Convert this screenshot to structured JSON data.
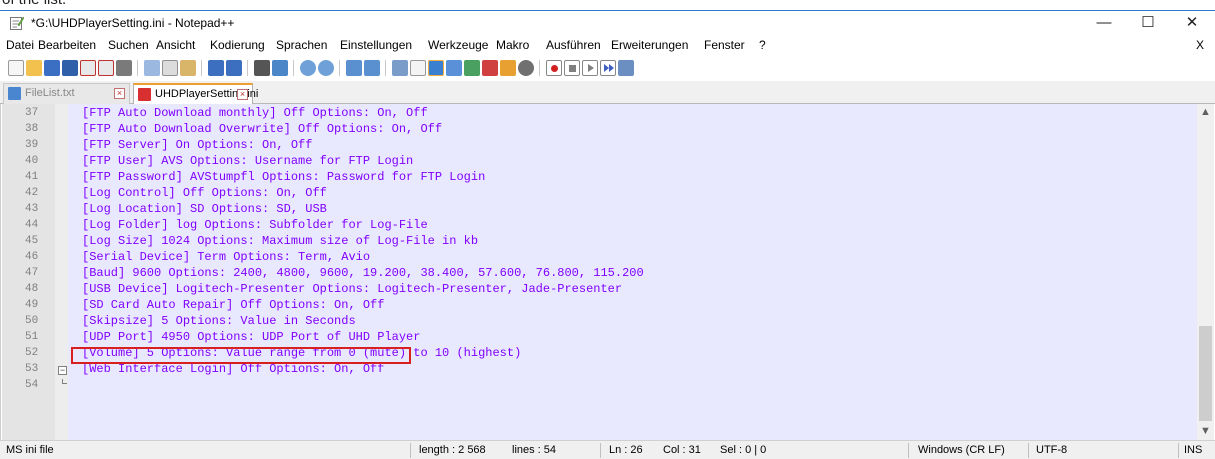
{
  "above_window_text": "of the list.",
  "window": {
    "title": "*G:\\UHDPlayerSetting.ini - Notepad++",
    "minimize": "—",
    "maximize": "☐",
    "close": "✕"
  },
  "menu": {
    "items": [
      "Datei",
      "Bearbeiten",
      "Suchen",
      "Ansicht",
      "Kodierung",
      "Sprachen",
      "Einstellungen",
      "Werkzeuge",
      "Makro",
      "Ausführen",
      "Erweiterungen",
      "Fenster",
      "?"
    ],
    "close_doc": "X"
  },
  "toolbar": {
    "icons": [
      "new-file-icon",
      "open-file-icon",
      "save-icon",
      "save-all-icon",
      "close-icon",
      "close-all-icon",
      "print-icon",
      "cut-icon",
      "copy-icon",
      "paste-icon",
      "undo-icon",
      "redo-icon",
      "find-icon",
      "replace-icon",
      "zoom-in-icon",
      "zoom-out-icon",
      "sync-vertical-icon",
      "sync-horizontal-icon",
      "word-wrap-icon",
      "show-all-chars-icon",
      "indent-guide-icon",
      "user-lang-icon",
      "doc-map-icon",
      "function-list-icon",
      "folder-workspace-icon",
      "monitor-icon",
      "record-macro-icon",
      "stop-record-icon",
      "play-macro-icon",
      "run-multiple-icon",
      "save-macro-icon"
    ]
  },
  "tabs": [
    {
      "label": "FileList.txt",
      "active": false,
      "close": "×"
    },
    {
      "label": "UHDPlayerSetting.ini",
      "active": true,
      "close": "×"
    }
  ],
  "editor": {
    "lines": [
      {
        "n": "37",
        "text": "[FTP Auto Download monthly] Off Options: On, Off"
      },
      {
        "n": "38",
        "text": "[FTP Auto Download Overwrite] Off Options: On, Off"
      },
      {
        "n": "39",
        "text": "[FTP Server] On Options: On, Off"
      },
      {
        "n": "40",
        "text": "[FTP User] AVS Options: Username for FTP Login"
      },
      {
        "n": "41",
        "text": "[FTP Password] AVStumpfl Options: Password for FTP Login"
      },
      {
        "n": "42",
        "text": "[Log Control] Off Options: On, Off"
      },
      {
        "n": "43",
        "text": "[Log Location] SD Options: SD, USB"
      },
      {
        "n": "44",
        "text": "[Log Folder] log Options: Subfolder for Log-File"
      },
      {
        "n": "45",
        "text": "[Log Size] 1024 Options: Maximum size of Log-File in kb"
      },
      {
        "n": "46",
        "text": "[Serial Device] Term Options: Term, Avio"
      },
      {
        "n": "47",
        "text": "[Baud] 9600 Options: 2400, 4800, 9600, 19.200, 38.400, 57.600, 76.800, 115.200"
      },
      {
        "n": "48",
        "text": "[USB Device] Logitech-Presenter Options: Logitech-Presenter, Jade-Presenter"
      },
      {
        "n": "49",
        "text": "[SD Card Auto Repair] Off Options: On, Off"
      },
      {
        "n": "50",
        "text": "[Skipsize] 5 Options: Value in Seconds"
      },
      {
        "n": "51",
        "text": "[UDP Port] 4950 Options: UDP Port of UHD Player"
      },
      {
        "n": "52",
        "text": "[Volume] 5 Options: Value range from 0 (mute) to 10 (highest)"
      },
      {
        "n": "53",
        "text": "[Web Interface Login] Off Options: On, Off"
      },
      {
        "n": "54",
        "text": ""
      }
    ],
    "highlighted_line": "50",
    "text_color": "#8000ff",
    "background_color": "#e8e8ff"
  },
  "status": {
    "file_type": "MS ini file",
    "length": "length : 2 568",
    "lines": "lines : 54",
    "ln": "Ln : 26",
    "col": "Col : 31",
    "sel": "Sel : 0 | 0",
    "eol": "Windows (CR LF)",
    "encoding": "UTF-8",
    "mode": "INS"
  }
}
